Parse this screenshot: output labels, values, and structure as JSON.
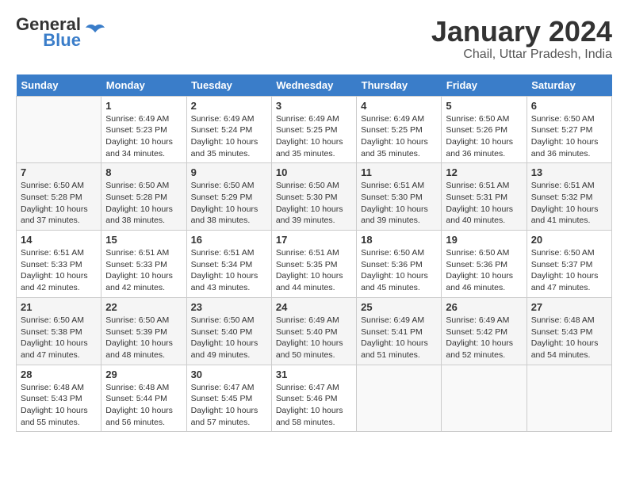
{
  "header": {
    "logo_general": "General",
    "logo_blue": "Blue",
    "month": "January 2024",
    "location": "Chail, Uttar Pradesh, India"
  },
  "calendar": {
    "weekdays": [
      "Sunday",
      "Monday",
      "Tuesday",
      "Wednesday",
      "Thursday",
      "Friday",
      "Saturday"
    ],
    "weeks": [
      [
        {
          "day": "",
          "sunrise": "",
          "sunset": "",
          "daylight": ""
        },
        {
          "day": "1",
          "sunrise": "Sunrise: 6:49 AM",
          "sunset": "Sunset: 5:23 PM",
          "daylight": "Daylight: 10 hours and 34 minutes."
        },
        {
          "day": "2",
          "sunrise": "Sunrise: 6:49 AM",
          "sunset": "Sunset: 5:24 PM",
          "daylight": "Daylight: 10 hours and 35 minutes."
        },
        {
          "day": "3",
          "sunrise": "Sunrise: 6:49 AM",
          "sunset": "Sunset: 5:25 PM",
          "daylight": "Daylight: 10 hours and 35 minutes."
        },
        {
          "day": "4",
          "sunrise": "Sunrise: 6:49 AM",
          "sunset": "Sunset: 5:25 PM",
          "daylight": "Daylight: 10 hours and 35 minutes."
        },
        {
          "day": "5",
          "sunrise": "Sunrise: 6:50 AM",
          "sunset": "Sunset: 5:26 PM",
          "daylight": "Daylight: 10 hours and 36 minutes."
        },
        {
          "day": "6",
          "sunrise": "Sunrise: 6:50 AM",
          "sunset": "Sunset: 5:27 PM",
          "daylight": "Daylight: 10 hours and 36 minutes."
        }
      ],
      [
        {
          "day": "7",
          "sunrise": "Sunrise: 6:50 AM",
          "sunset": "Sunset: 5:28 PM",
          "daylight": "Daylight: 10 hours and 37 minutes."
        },
        {
          "day": "8",
          "sunrise": "Sunrise: 6:50 AM",
          "sunset": "Sunset: 5:28 PM",
          "daylight": "Daylight: 10 hours and 38 minutes."
        },
        {
          "day": "9",
          "sunrise": "Sunrise: 6:50 AM",
          "sunset": "Sunset: 5:29 PM",
          "daylight": "Daylight: 10 hours and 38 minutes."
        },
        {
          "day": "10",
          "sunrise": "Sunrise: 6:50 AM",
          "sunset": "Sunset: 5:30 PM",
          "daylight": "Daylight: 10 hours and 39 minutes."
        },
        {
          "day": "11",
          "sunrise": "Sunrise: 6:51 AM",
          "sunset": "Sunset: 5:30 PM",
          "daylight": "Daylight: 10 hours and 39 minutes."
        },
        {
          "day": "12",
          "sunrise": "Sunrise: 6:51 AM",
          "sunset": "Sunset: 5:31 PM",
          "daylight": "Daylight: 10 hours and 40 minutes."
        },
        {
          "day": "13",
          "sunrise": "Sunrise: 6:51 AM",
          "sunset": "Sunset: 5:32 PM",
          "daylight": "Daylight: 10 hours and 41 minutes."
        }
      ],
      [
        {
          "day": "14",
          "sunrise": "Sunrise: 6:51 AM",
          "sunset": "Sunset: 5:33 PM",
          "daylight": "Daylight: 10 hours and 42 minutes."
        },
        {
          "day": "15",
          "sunrise": "Sunrise: 6:51 AM",
          "sunset": "Sunset: 5:33 PM",
          "daylight": "Daylight: 10 hours and 42 minutes."
        },
        {
          "day": "16",
          "sunrise": "Sunrise: 6:51 AM",
          "sunset": "Sunset: 5:34 PM",
          "daylight": "Daylight: 10 hours and 43 minutes."
        },
        {
          "day": "17",
          "sunrise": "Sunrise: 6:51 AM",
          "sunset": "Sunset: 5:35 PM",
          "daylight": "Daylight: 10 hours and 44 minutes."
        },
        {
          "day": "18",
          "sunrise": "Sunrise: 6:50 AM",
          "sunset": "Sunset: 5:36 PM",
          "daylight": "Daylight: 10 hours and 45 minutes."
        },
        {
          "day": "19",
          "sunrise": "Sunrise: 6:50 AM",
          "sunset": "Sunset: 5:36 PM",
          "daylight": "Daylight: 10 hours and 46 minutes."
        },
        {
          "day": "20",
          "sunrise": "Sunrise: 6:50 AM",
          "sunset": "Sunset: 5:37 PM",
          "daylight": "Daylight: 10 hours and 47 minutes."
        }
      ],
      [
        {
          "day": "21",
          "sunrise": "Sunrise: 6:50 AM",
          "sunset": "Sunset: 5:38 PM",
          "daylight": "Daylight: 10 hours and 47 minutes."
        },
        {
          "day": "22",
          "sunrise": "Sunrise: 6:50 AM",
          "sunset": "Sunset: 5:39 PM",
          "daylight": "Daylight: 10 hours and 48 minutes."
        },
        {
          "day": "23",
          "sunrise": "Sunrise: 6:50 AM",
          "sunset": "Sunset: 5:40 PM",
          "daylight": "Daylight: 10 hours and 49 minutes."
        },
        {
          "day": "24",
          "sunrise": "Sunrise: 6:49 AM",
          "sunset": "Sunset: 5:40 PM",
          "daylight": "Daylight: 10 hours and 50 minutes."
        },
        {
          "day": "25",
          "sunrise": "Sunrise: 6:49 AM",
          "sunset": "Sunset: 5:41 PM",
          "daylight": "Daylight: 10 hours and 51 minutes."
        },
        {
          "day": "26",
          "sunrise": "Sunrise: 6:49 AM",
          "sunset": "Sunset: 5:42 PM",
          "daylight": "Daylight: 10 hours and 52 minutes."
        },
        {
          "day": "27",
          "sunrise": "Sunrise: 6:48 AM",
          "sunset": "Sunset: 5:43 PM",
          "daylight": "Daylight: 10 hours and 54 minutes."
        }
      ],
      [
        {
          "day": "28",
          "sunrise": "Sunrise: 6:48 AM",
          "sunset": "Sunset: 5:43 PM",
          "daylight": "Daylight: 10 hours and 55 minutes."
        },
        {
          "day": "29",
          "sunrise": "Sunrise: 6:48 AM",
          "sunset": "Sunset: 5:44 PM",
          "daylight": "Daylight: 10 hours and 56 minutes."
        },
        {
          "day": "30",
          "sunrise": "Sunrise: 6:47 AM",
          "sunset": "Sunset: 5:45 PM",
          "daylight": "Daylight: 10 hours and 57 minutes."
        },
        {
          "day": "31",
          "sunrise": "Sunrise: 6:47 AM",
          "sunset": "Sunset: 5:46 PM",
          "daylight": "Daylight: 10 hours and 58 minutes."
        },
        {
          "day": "",
          "sunrise": "",
          "sunset": "",
          "daylight": ""
        },
        {
          "day": "",
          "sunrise": "",
          "sunset": "",
          "daylight": ""
        },
        {
          "day": "",
          "sunrise": "",
          "sunset": "",
          "daylight": ""
        }
      ]
    ]
  }
}
